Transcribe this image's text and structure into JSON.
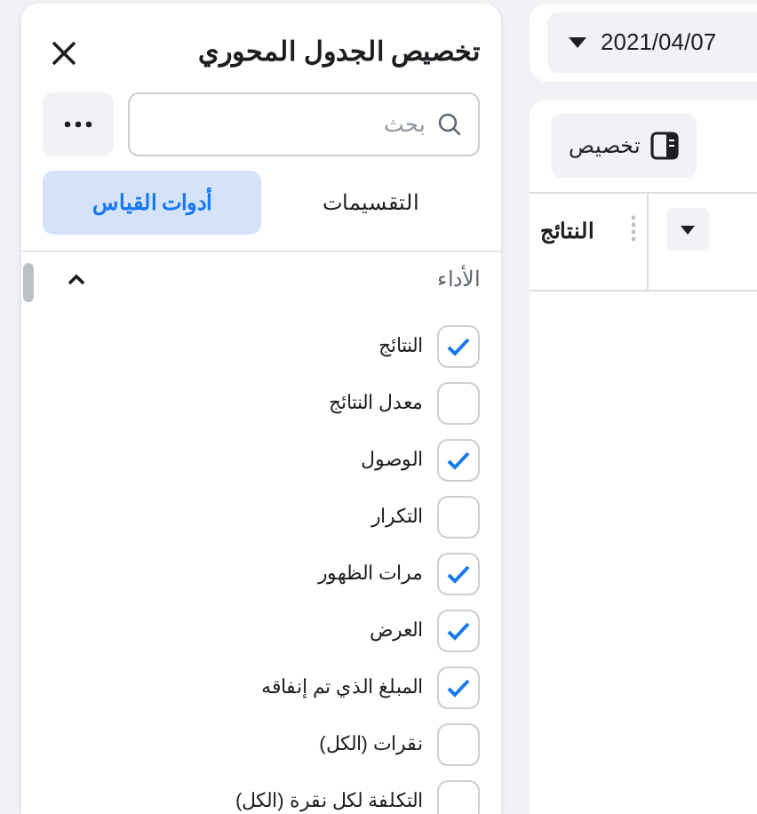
{
  "panel": {
    "title": "تخصيص الجدول المحوري",
    "search": {
      "placeholder": "بحث"
    },
    "tabs": [
      {
        "label": "التقسيمات",
        "selected": false
      },
      {
        "label": "أدوات القياس",
        "selected": true
      }
    ],
    "section": {
      "title": "الأداء",
      "expanded": true
    },
    "items": [
      {
        "label": "النتائج",
        "checked": true
      },
      {
        "label": "معدل النتائج",
        "checked": false
      },
      {
        "label": "الوصول",
        "checked": true
      },
      {
        "label": "التكرار",
        "checked": false
      },
      {
        "label": "مرات الظهور",
        "checked": true
      },
      {
        "label": "العرض",
        "checked": true
      },
      {
        "label": "المبلغ الذي تم إنفاقه",
        "checked": true
      },
      {
        "label": "نقرات (الكل)",
        "checked": false
      },
      {
        "label": "التكلفة لكل نقرة (الكل)",
        "checked": false
      }
    ]
  },
  "date_range": "2021/04/07",
  "toolbar": {
    "customize_button": "تخصيص"
  },
  "table": {
    "columns": [
      "النتائج"
    ]
  }
}
